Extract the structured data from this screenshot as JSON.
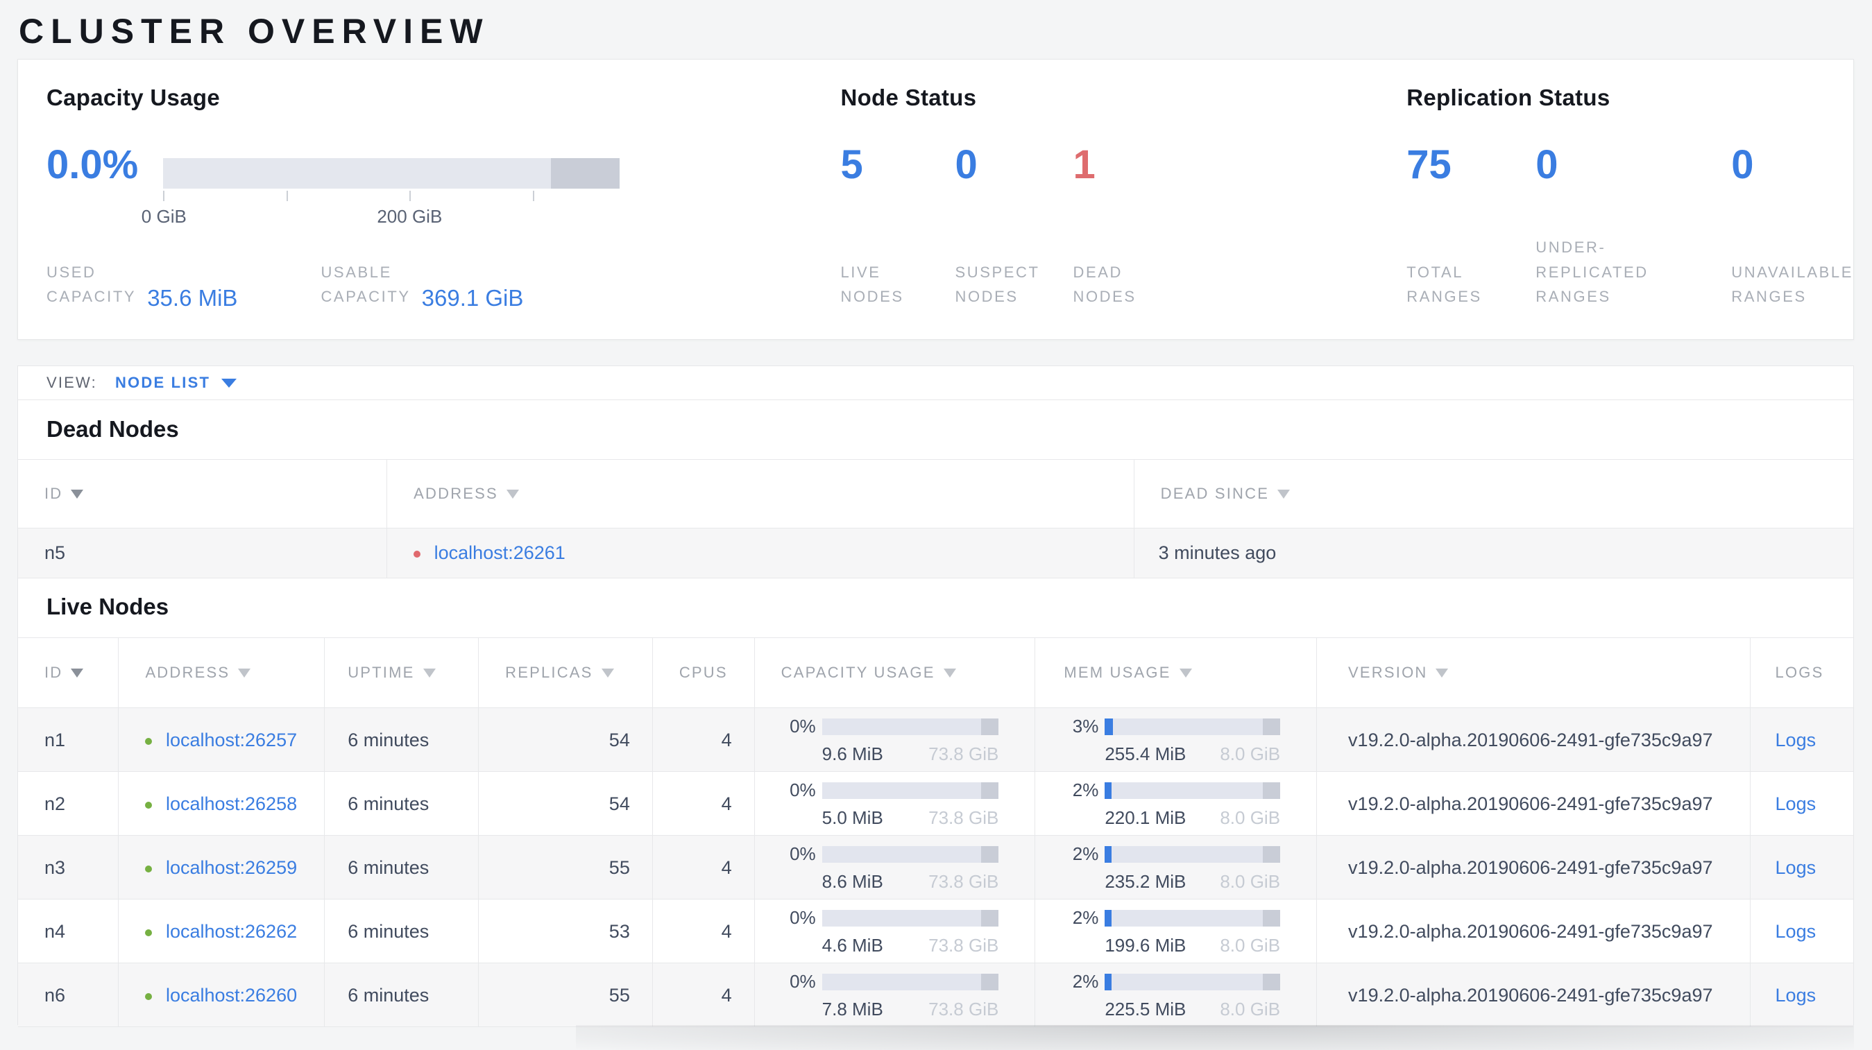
{
  "colors": {
    "accent_blue": "#3a7de1",
    "dead_red": "#de6c6e",
    "live_green": "#76b042",
    "page_background": "#f4f5f6"
  },
  "page_title": "CLUSTER OVERVIEW",
  "summary": {
    "capacity": {
      "heading": "Capacity Usage",
      "percent": "0.0%",
      "bar": {
        "used_fill_pct": 0,
        "reserved_tail_pct": 15
      },
      "tick_labels": [
        "0 GiB",
        "200 GiB"
      ],
      "stats": [
        {
          "label_lines": [
            "USED",
            "CAPACITY"
          ],
          "value": "35.6 MiB"
        },
        {
          "label_lines": [
            "USABLE",
            "CAPACITY"
          ],
          "value": "369.1 GiB"
        }
      ]
    },
    "node_status": {
      "heading": "Node Status",
      "stats": [
        {
          "value": "5",
          "label_lines": [
            "LIVE",
            "NODES"
          ],
          "state": "live"
        },
        {
          "value": "0",
          "label_lines": [
            "SUSPECT",
            "NODES"
          ],
          "state": "suspect"
        },
        {
          "value": "1",
          "label_lines": [
            "DEAD",
            "NODES"
          ],
          "state": "dead"
        }
      ]
    },
    "replication_status": {
      "heading": "Replication Status",
      "stats": [
        {
          "value": "75",
          "label_lines": [
            "TOTAL",
            "RANGES"
          ]
        },
        {
          "value": "0",
          "label_lines": [
            "UNDER-",
            "REPLICATED",
            "RANGES"
          ]
        },
        {
          "value": "0",
          "label_lines": [
            "UNAVAILABLE",
            "RANGES"
          ]
        }
      ]
    }
  },
  "view_bar": {
    "label": "VIEW:",
    "value": "NODE LIST"
  },
  "dead_nodes": {
    "heading": "Dead Nodes",
    "columns": [
      {
        "label": "ID"
      },
      {
        "label": "ADDRESS"
      },
      {
        "label": "DEAD SINCE"
      }
    ],
    "rows": [
      {
        "id": "n5",
        "address": "localhost:26261",
        "dead_since": "3 minutes ago"
      }
    ]
  },
  "live_nodes": {
    "heading": "Live Nodes",
    "columns": [
      {
        "label": "ID"
      },
      {
        "label": "ADDRESS"
      },
      {
        "label": "UPTIME"
      },
      {
        "label": "REPLICAS"
      },
      {
        "label": "CPUS"
      },
      {
        "label": "CAPACITY USAGE"
      },
      {
        "label": "MEM USAGE"
      },
      {
        "label": "VERSION"
      },
      {
        "label": "LOGS"
      }
    ],
    "rows": [
      {
        "id": "n1",
        "address": "localhost:26257",
        "uptime": "6 minutes",
        "replicas": "54",
        "cpus": "4",
        "capacity": {
          "pct": "0%",
          "used": "9.6 MiB",
          "total": "73.8 GiB",
          "fill_pct": 0
        },
        "mem": {
          "pct": "3%",
          "used": "255.4 MiB",
          "total": "8.0 GiB",
          "fill_pct": 4.7
        },
        "version": "v19.2.0-alpha.20190606-2491-gfe735c9a97",
        "logs_label": "Logs"
      },
      {
        "id": "n2",
        "address": "localhost:26258",
        "uptime": "6 minutes",
        "replicas": "54",
        "cpus": "4",
        "capacity": {
          "pct": "0%",
          "used": "5.0 MiB",
          "total": "73.8 GiB",
          "fill_pct": 0
        },
        "mem": {
          "pct": "2%",
          "used": "220.1 MiB",
          "total": "8.0 GiB",
          "fill_pct": 4
        },
        "version": "v19.2.0-alpha.20190606-2491-gfe735c9a97",
        "logs_label": "Logs"
      },
      {
        "id": "n3",
        "address": "localhost:26259",
        "uptime": "6 minutes",
        "replicas": "55",
        "cpus": "4",
        "capacity": {
          "pct": "0%",
          "used": "8.6 MiB",
          "total": "73.8 GiB",
          "fill_pct": 0
        },
        "mem": {
          "pct": "2%",
          "used": "235.2 MiB",
          "total": "8.0 GiB",
          "fill_pct": 4
        },
        "version": "v19.2.0-alpha.20190606-2491-gfe735c9a97",
        "logs_label": "Logs"
      },
      {
        "id": "n4",
        "address": "localhost:26262",
        "uptime": "6 minutes",
        "replicas": "53",
        "cpus": "4",
        "capacity": {
          "pct": "0%",
          "used": "4.6 MiB",
          "total": "73.8 GiB",
          "fill_pct": 0
        },
        "mem": {
          "pct": "2%",
          "used": "199.6 MiB",
          "total": "8.0 GiB",
          "fill_pct": 4
        },
        "version": "v19.2.0-alpha.20190606-2491-gfe735c9a97",
        "logs_label": "Logs"
      },
      {
        "id": "n6",
        "address": "localhost:26260",
        "uptime": "6 minutes",
        "replicas": "55",
        "cpus": "4",
        "capacity": {
          "pct": "0%",
          "used": "7.8 MiB",
          "total": "73.8 GiB",
          "fill_pct": 0
        },
        "mem": {
          "pct": "2%",
          "used": "225.5 MiB",
          "total": "8.0 GiB",
          "fill_pct": 4
        },
        "version": "v19.2.0-alpha.20190606-2491-gfe735c9a97",
        "logs_label": "Logs"
      }
    ]
  }
}
